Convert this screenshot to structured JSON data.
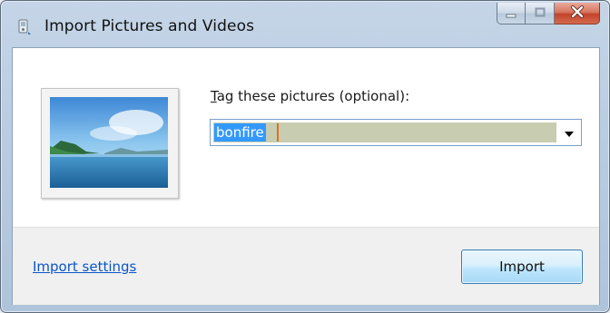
{
  "window": {
    "title": "Import Pictures and Videos",
    "icons": {
      "app": "camera-import-icon",
      "minimize": "minimize-icon",
      "maximize": "maximize-icon",
      "close": "close-icon"
    }
  },
  "form": {
    "tag_label_accesskey": "T",
    "tag_label_rest": "ag these pictures (optional):",
    "tag_value": "bonfire",
    "dropdown_icon": "chevron-down-icon",
    "thumbnail_icon": "landscape-picture-icon"
  },
  "footer": {
    "settings_link": "Import settings",
    "import_button": "Import"
  },
  "colors": {
    "selection": "#3399ff",
    "link": "#0a55c9",
    "close_button": "#c2432b",
    "field_fill": "#c8ccb1"
  }
}
